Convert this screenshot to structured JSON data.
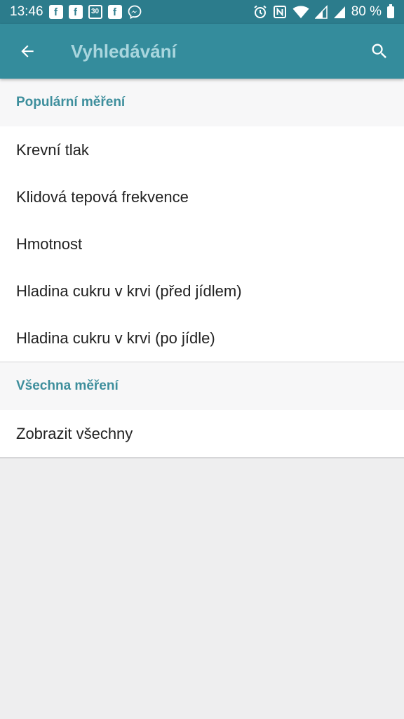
{
  "status_bar": {
    "time": "13:46",
    "notif_calendar": "30",
    "battery_text": "80 %"
  },
  "app_bar": {
    "title": "Vyhledávání",
    "back_icon": "arrow-left-icon",
    "search_icon": "search-icon"
  },
  "sections": {
    "popular": {
      "header": "Populární měření",
      "items": [
        {
          "label": "Krevní tlak"
        },
        {
          "label": "Klidová tepová frekvence"
        },
        {
          "label": "Hmotnost"
        },
        {
          "label": "Hladina cukru v krvi (před jídlem)"
        },
        {
          "label": "Hladina cukru v krvi (po jídle)"
        }
      ]
    },
    "all": {
      "header": "Všechna měření",
      "items": [
        {
          "label": "Zobrazit všechny"
        }
      ]
    }
  },
  "colors": {
    "status_bar": "#2c7c8c",
    "app_bar": "#348c9c",
    "title": "#a9d6de",
    "section_header_text": "#3d8e9c",
    "background": "#eeeeef"
  }
}
